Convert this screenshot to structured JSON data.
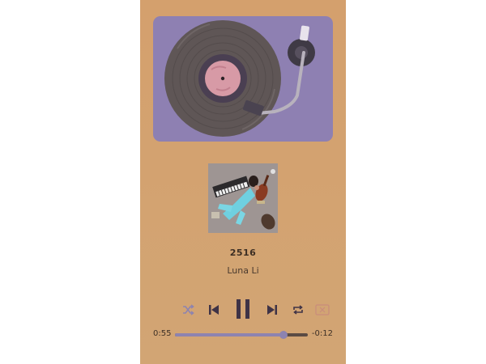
{
  "player": {
    "track_title": "2516",
    "artist": "Luna Li",
    "elapsed": "0:55",
    "remaining": "-0:12",
    "progress_fraction": 0.82
  },
  "controls": {
    "shuffle_icon": "shuffle-icon",
    "prev_icon": "skip-previous-icon",
    "play_pause_icon": "pause-icon",
    "next_icon": "skip-next-icon",
    "repeat_icon": "repeat-icon",
    "close_icon": "close-box-icon"
  },
  "colors": {
    "background": "#d4a06d",
    "turntable": "#8e80b2",
    "accent": "#8d83b0",
    "record": "#5f5656",
    "label": "#d79aa6"
  }
}
